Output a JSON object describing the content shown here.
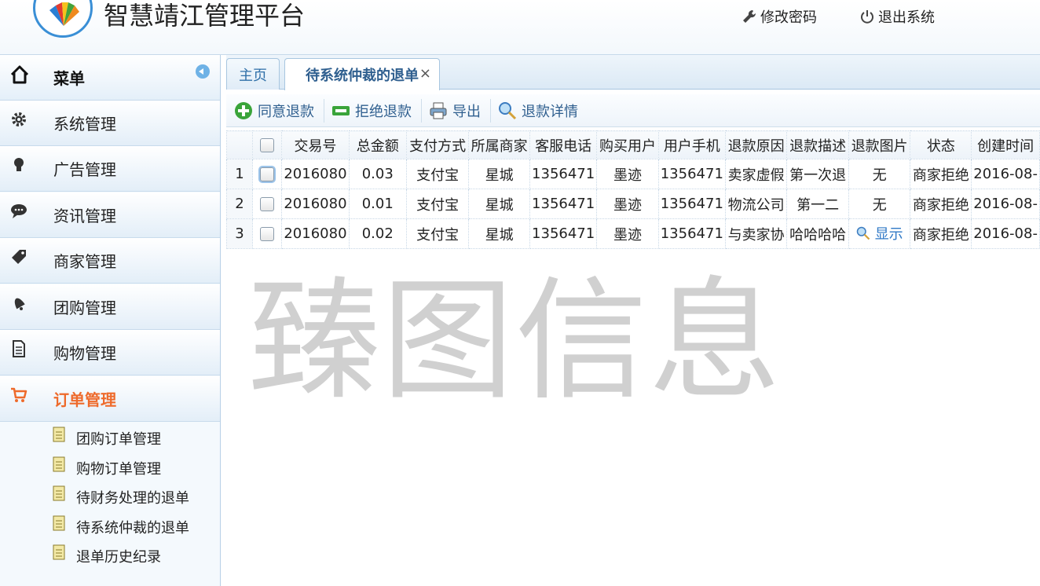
{
  "header": {
    "title": "智慧靖江管理平台",
    "change_password": "修改密码",
    "logout": "退出系统"
  },
  "sidebar": {
    "menu_title": "菜单",
    "items": [
      {
        "label": "系统管理",
        "icon": "gear-icon"
      },
      {
        "label": "广告管理",
        "icon": "lightbulb-icon"
      },
      {
        "label": "资讯管理",
        "icon": "chat-bubble-icon"
      },
      {
        "label": "商家管理",
        "icon": "tag-icon"
      },
      {
        "label": "团购管理",
        "icon": "bell-icon"
      },
      {
        "label": "购物管理",
        "icon": "document-icon"
      },
      {
        "label": "订单管理",
        "icon": "cart-icon",
        "active": true
      }
    ],
    "sub_items": [
      {
        "label": "团购订单管理"
      },
      {
        "label": "购物订单管理"
      },
      {
        "label": "待财务处理的退单"
      },
      {
        "label": "待系统仲裁的退单"
      },
      {
        "label": "退单历史纪录"
      }
    ]
  },
  "tabs": {
    "home": "主页",
    "active": "待系统仲裁的退单",
    "close_symbol": "×"
  },
  "toolbar": {
    "agree": "同意退款",
    "reject": "拒绝退款",
    "export": "导出",
    "details": "退款详情"
  },
  "table": {
    "columns": [
      "交易号",
      "总金额",
      "支付方式",
      "所属商家",
      "客服电话",
      "购买用户",
      "用户手机",
      "退款原因",
      "退款描述",
      "退款图片",
      "状态",
      "创建时间"
    ],
    "rows": [
      {
        "num": "1",
        "trade_no": "2016080",
        "amount": "0.03",
        "pay": "支付宝",
        "merchant": "星城",
        "phone": "1356471",
        "user": "墨迹",
        "mobile": "1356471",
        "reason": "卖家虚假",
        "desc": "第一次退",
        "image": "无",
        "status": "商家拒绝",
        "created": "2016-08-"
      },
      {
        "num": "2",
        "trade_no": "2016080",
        "amount": "0.01",
        "pay": "支付宝",
        "merchant": "星城",
        "phone": "1356471",
        "user": "墨迹",
        "mobile": "1356471",
        "reason": "物流公司",
        "desc": "第一二",
        "image": "无",
        "status": "商家拒绝",
        "created": "2016-08-"
      },
      {
        "num": "3",
        "trade_no": "2016080",
        "amount": "0.02",
        "pay": "支付宝",
        "merchant": "星城",
        "phone": "1356471",
        "user": "墨迹",
        "mobile": "1356471",
        "reason": "与卖家协",
        "desc": "哈哈哈哈",
        "image": "显示",
        "status": "商家拒绝",
        "created": "2016-08-"
      }
    ]
  },
  "watermark": "臻图信息",
  "colors": {
    "accent_orange": "#ee6a2b",
    "link_blue": "#2f78c6",
    "tab_text": "#2f5f8f"
  }
}
